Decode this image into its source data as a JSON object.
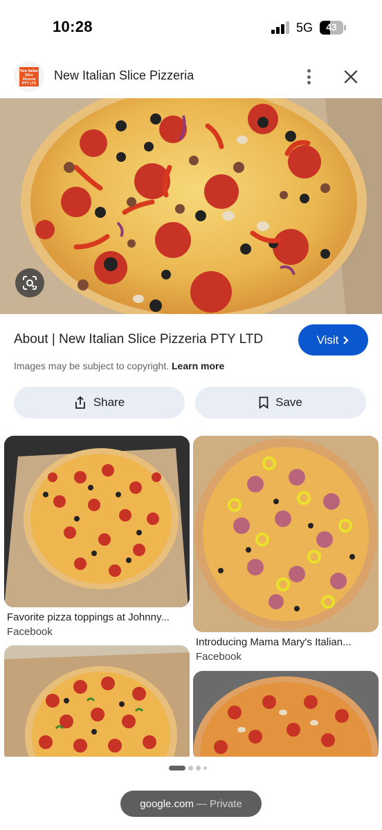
{
  "status_bar": {
    "time": "10:28",
    "network": "5G",
    "battery_level": "43"
  },
  "header": {
    "title": "New Italian Slice Pizzeria",
    "logo_text": "New Italian Slice Pizzeria PTY LTD",
    "more_icon": "more-vert-icon",
    "close_icon": "close-icon"
  },
  "hero": {
    "lens_icon": "lens-search-icon"
  },
  "about": {
    "title": "About | New Italian Slice Pizzeria PTY LTD",
    "visit_label": "Visit",
    "copyright_text": "Images may be subject to copyright.",
    "learn_more": "Learn more",
    "share_label": "Share",
    "save_label": "Save"
  },
  "results": [
    {
      "caption": "Favorite pizza toppings at Johnny...",
      "source": "Facebook"
    },
    {
      "caption": "Introducing Mama Mary's Italian...",
      "source": "Facebook"
    },
    {
      "caption": "",
      "source": ""
    },
    {
      "caption": "",
      "source": ""
    }
  ],
  "bottom": {
    "domain": "google.com",
    "mode": "— Private"
  },
  "colors": {
    "accent": "#0b57d0",
    "chip": "#e9eef6",
    "pill": "#5e5e5e"
  }
}
